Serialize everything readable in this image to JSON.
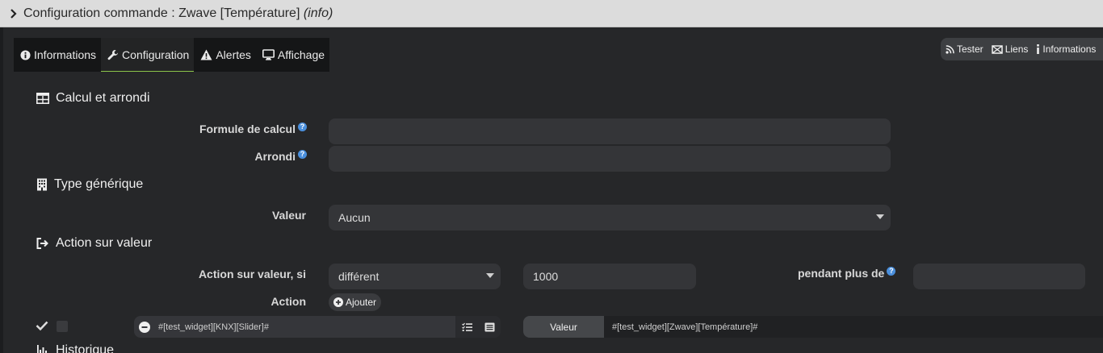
{
  "window": {
    "title": "Configuration commande : Zwave [Température]",
    "title_suffix": "(info)"
  },
  "tabs": [
    {
      "label": "Informations",
      "icon": "info-circle-icon"
    },
    {
      "label": "Configuration",
      "icon": "wrench-icon",
      "active": true
    },
    {
      "label": "Alertes",
      "icon": "warning-icon"
    },
    {
      "label": "Affichage",
      "icon": "monitor-icon"
    }
  ],
  "toolbar": {
    "tester": "Tester",
    "liens": "Liens",
    "informations": "Informations"
  },
  "sections": {
    "calcul": "Calcul et arrondi",
    "type": "Type générique",
    "action": "Action sur valeur",
    "historique": "Historique"
  },
  "fields": {
    "formule_label": "Formule de calcul",
    "formule_value": "",
    "arrondi_label": "Arrondi",
    "arrondi_value": "",
    "valeur_label": "Valeur",
    "valeur_selected": "Aucun",
    "action_sur_valeur_label": "Action sur valeur, si",
    "condition_selected": "différent",
    "condition_value": "1000",
    "pendant_label": "pendant plus de",
    "pendant_value": "",
    "action_label": "Action",
    "ajouter": "Ajouter"
  },
  "action_row": {
    "command": "#[test_widget][KNX][Slider]#",
    "valeur_label": "Valeur",
    "valeur_value": "#[test_widget][Zwave][Température]#"
  },
  "colors": {
    "active_tab_underline": "#8bc34a",
    "help_icon": "#4a8fdc"
  }
}
